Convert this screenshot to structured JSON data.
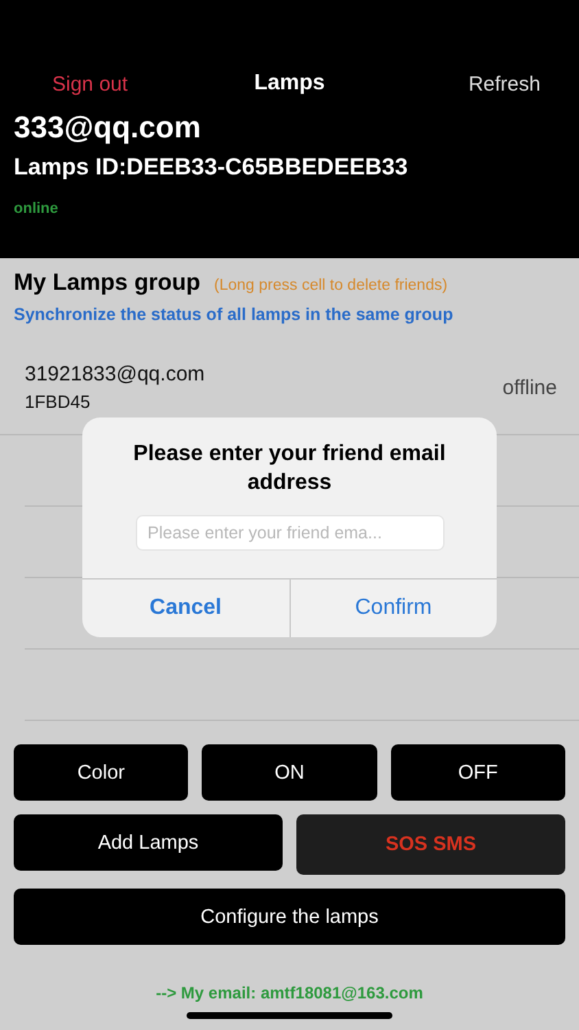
{
  "nav": {
    "left": "Sign out",
    "title": "Lamps",
    "right": "Refresh"
  },
  "account": {
    "email": "333@qq.com",
    "lamps_id": "Lamps ID:DEEB33-C65BBEDEEB33",
    "status": "online",
    "online": true
  },
  "group": {
    "title": "My Lamps group",
    "hint": "(Long press cell to delete friends)",
    "sync": "Synchronize the status of all lamps in the same group"
  },
  "friends": [
    {
      "email": "31921833@qq.com",
      "id": "1FBD45",
      "status": "offline",
      "online": false
    }
  ],
  "buttons": [
    [
      {
        "label": "Color",
        "kind": "normal"
      },
      {
        "label": "ON",
        "kind": "normal"
      },
      {
        "label": "OFF",
        "kind": "normal"
      }
    ],
    [
      {
        "label": "Add Lamps",
        "kind": "normal"
      },
      {
        "label": "SOS SMS",
        "kind": "alert"
      }
    ],
    [
      {
        "label": "Configure the lamps",
        "kind": "normal"
      }
    ]
  ],
  "footer": "--> My email: amtf18081@163.com",
  "dialog": {
    "title": "Please enter your friend email address",
    "placeholder": "Please enter your friend ema...",
    "actions": [
      {
        "label": "Cancel",
        "kind": "cancel"
      },
      {
        "label": "Confirm",
        "kind": "default"
      }
    ]
  }
}
